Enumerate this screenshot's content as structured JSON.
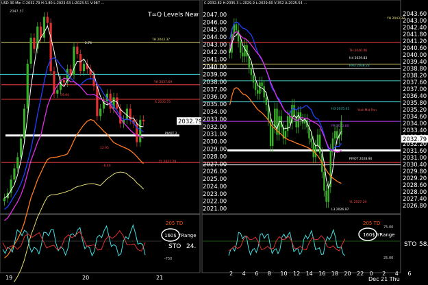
{
  "window_title": "T=Q Levels New",
  "left": {
    "header": "USD 30 Min C:2032.79 H:1.80 L:2023.63 L:2023.51 V:987 ...",
    "top_price": "2047.37",
    "x_labels": [
      "19",
      "20",
      "21"
    ],
    "level_labels": [
      {
        "text": "TH 2043.37",
        "color": "#e8e070"
      },
      {
        "text": "YH 2037.69",
        "color": "#ff5050"
      },
      {
        "text": "R 2035.75",
        "color": "#ff4040"
      },
      {
        "text": "PIVOT 2",
        "color": "#ffffff"
      },
      {
        "text": "YL 2027.29",
        "color": "#ff4040"
      },
      {
        "text": "12.95",
        "color": "#ff4040"
      },
      {
        "text": "-8.40",
        "color": "#ff4040"
      },
      {
        "text": "2.74",
        "color": "#ffffff"
      },
      {
        "text": "59.94",
        "color": "#ff4040"
      }
    ],
    "indicator": {
      "td_label": "205 TD",
      "yrange_label": "160$ YRange",
      "sto_label": "STO",
      "sto_value": "24.",
      "tick_label": "-750"
    }
  },
  "right": {
    "header": "C:2032.82 H:2035.3 L:2029.9 L:2029.60 V:352 A:2025.54 ...",
    "y_ticks": [
      "2047.00",
      "2046.00",
      "2045.00",
      "2044.00",
      "2043.00",
      "2042.00",
      "2041.00",
      "2040.00",
      "2039.00",
      "2038.00",
      "2037.00",
      "2036.00",
      "2035.00",
      "2034.00",
      "2033.00",
      "2032.00",
      "2031.00",
      "2030.00",
      "2029.00",
      "2028.00",
      "2027.00",
      "2026.00",
      "2025.00",
      "2024.00",
      "2023.00",
      "2022.00",
      "2021.00"
    ],
    "y_ticks_right": [
      "2043.60",
      "2043.00",
      "2042.40",
      "2041.80",
      "2041.20",
      "2040.60",
      "2040.00",
      "2039.40",
      "2038.80",
      "2038.20",
      "2037.60",
      "2037.00",
      "2036.40",
      "2035.80",
      "2035.20",
      "2034.60",
      "2034.00",
      "2033.40",
      "2032.80",
      "2032.20",
      "2031.60",
      "2031.00",
      "2030.40",
      "2029.80",
      "2029.20",
      "2028.60",
      "2028.00",
      "2027.40",
      "2026.80"
    ],
    "current_price": "2032.79",
    "x_labels": [
      "2",
      "4",
      "6",
      "8",
      "10",
      "12",
      "14",
      "16",
      "18",
      "20",
      "22",
      "0",
      "2",
      "4",
      "6"
    ],
    "date_label": "Dec 21 Thu",
    "level_labels": [
      {
        "text": "YH 2043.37",
        "color": "#e8e070"
      },
      {
        "text": "TH 2040.46",
        "color": "#ff5050"
      },
      {
        "text": "H4 2039.83",
        "color": "#ffffff"
      },
      {
        "text": "HH3 2038.23",
        "color": "#40d0d0"
      },
      {
        "text": "H3 2035.41",
        "color": "#40d0d0"
      },
      {
        "text": "Yest Mid Pon",
        "color": "#ff5050"
      },
      {
        "text": "PP 2032.80",
        "color": "#c040ff"
      },
      {
        "text": "PIVOT 2028.90",
        "color": "#ffffff"
      },
      {
        "text": "YL 2027.29",
        "color": "#ff4040"
      },
      {
        "text": "L3 2026.97",
        "color": "#ffffff"
      }
    ],
    "indicator": {
      "td_label": "205 TD",
      "yrange_label": "160$ YRange",
      "sto_label": "STO",
      "sto_value": "58.",
      "tick_top": "75.00",
      "tick_bottom": "25.00"
    }
  },
  "chart_data": [
    {
      "type": "candlestick",
      "title": "T=Q Levels New",
      "ylim": [
        2021,
        2047
      ],
      "x_ticks": [
        "19",
        "20",
        "21"
      ],
      "horizontal_levels": [
        {
          "name": "TH",
          "value": 2043.37
        },
        {
          "name": "YH",
          "value": 2037.69
        },
        {
          "name": "R",
          "value": 2035.75
        },
        {
          "name": "PIVOT",
          "value": 2030.9
        },
        {
          "name": "YL",
          "value": 2027.29
        }
      ],
      "series": [
        {
          "name": "Close",
          "values": [
            2022.5,
            2023.2,
            2025.0,
            2026.5,
            2028.0,
            2030.5,
            2034.5,
            2040.5,
            2044.0,
            2042.5,
            2045.5,
            2044.0,
            2046.8,
            2046.0,
            2039.5,
            2036.5,
            2037.0,
            2038.3,
            2038.0,
            2039.8,
            2039.0,
            2042.8,
            2041.8,
            2039.5,
            2040.5,
            2039.8,
            2039.0,
            2037.5,
            2033.5,
            2034.5,
            2035.5,
            2036.5,
            2034.5,
            2036.0,
            2034.5,
            2032.5,
            2033.0,
            2034.5,
            2033.0,
            2032.5,
            2030.0,
            2033.0,
            2032.8
          ]
        }
      ]
    },
    {
      "type": "candlestick",
      "ylim": [
        2021,
        2047
      ],
      "x_ticks": [
        "2",
        "4",
        "6",
        "8",
        "10",
        "12",
        "14",
        "16",
        "18",
        "20",
        "22",
        "0",
        "2",
        "4",
        "6"
      ],
      "horizontal_levels": [
        {
          "name": "YH",
          "value": 2043.37
        },
        {
          "name": "TH",
          "value": 2040.46
        },
        {
          "name": "H4",
          "value": 2039.83
        },
        {
          "name": "HH3",
          "value": 2038.23
        },
        {
          "name": "H3",
          "value": 2035.41
        },
        {
          "name": "PP",
          "value": 2032.8
        },
        {
          "name": "PIVOT",
          "value": 2028.9
        },
        {
          "name": "YL",
          "value": 2027.29
        },
        {
          "name": "L3",
          "value": 2026.97
        }
      ],
      "series": [
        {
          "name": "Close",
          "values": [
            2042.0,
            2044.5,
            2045.8,
            2045.0,
            2043.5,
            2042.0,
            2041.5,
            2043.0,
            2041.5,
            2040.0,
            2039.0,
            2038.0,
            2037.0,
            2036.5,
            2038.0,
            2037.5,
            2036.0,
            2035.0,
            2033.0,
            2029.5,
            2032.0,
            2034.5,
            2031.0,
            2033.5,
            2032.0,
            2030.5,
            2031.5,
            2033.5,
            2032.5,
            2035.0,
            2033.5,
            2032.0,
            2034.0,
            2033.0,
            2032.5,
            2033.0,
            2032.0,
            2030.5,
            2030.0,
            2028.0,
            2029.5,
            2031.0,
            2028.5,
            2026.0,
            2023.5,
            2022.0,
            2024.0,
            2029.0,
            2030.5,
            2031.5,
            2030.5,
            2031.0,
            2032.8
          ]
        }
      ]
    }
  ]
}
